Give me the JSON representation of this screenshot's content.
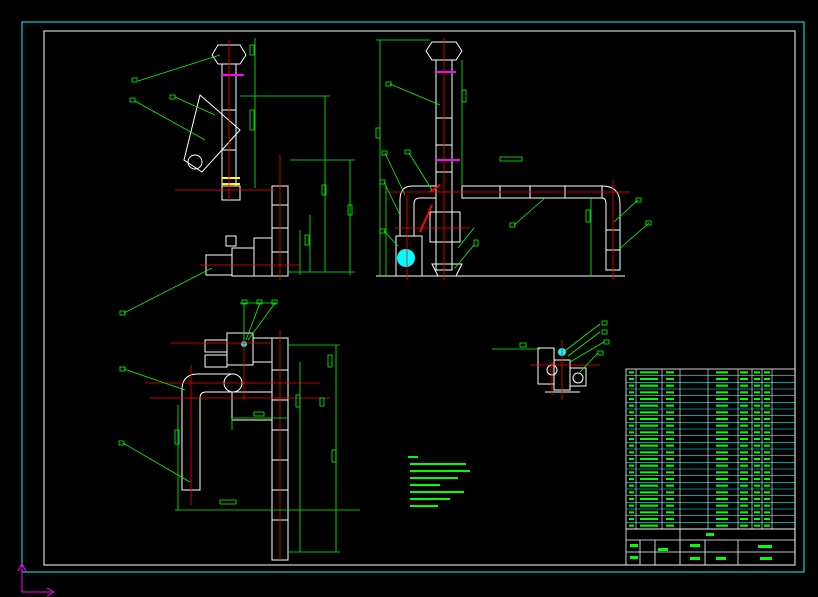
{
  "drawing": {
    "description_visible_text": [],
    "colors": {
      "background": "#000000",
      "border": "#00ffff",
      "outline": "#ffffff",
      "leader": "#00ff00",
      "dimension": "#00ff00",
      "centerline": "#ff0000",
      "marker": "#ff00ff",
      "accent": "#ffff00",
      "cyan": "#00ffff"
    },
    "ucs_icon": "ucs-axis-icon",
    "title_block": {
      "rows": 24
    }
  }
}
